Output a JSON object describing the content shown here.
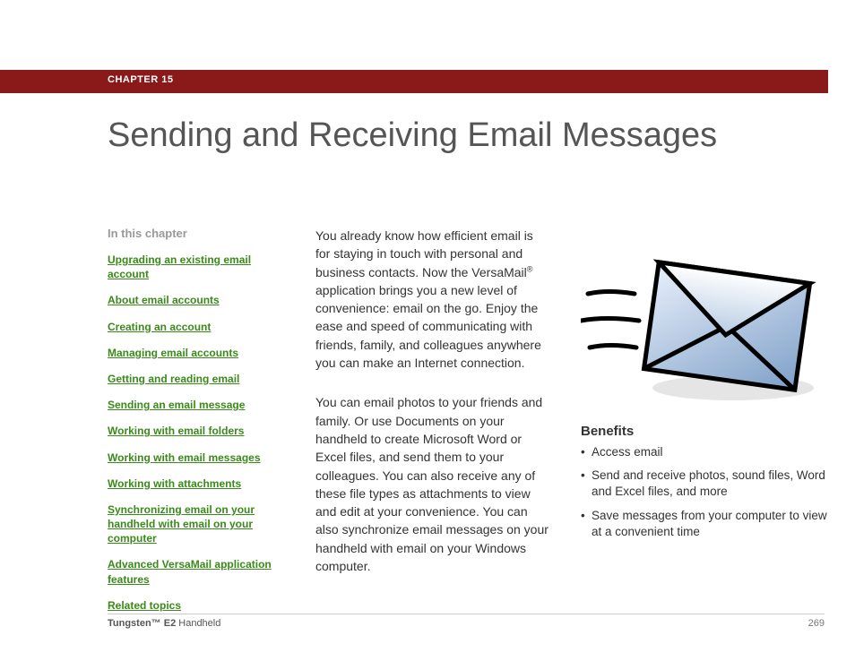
{
  "chapter": {
    "label": "CHAPTER 15"
  },
  "title": "Sending and Receiving Email Messages",
  "sidebar": {
    "heading": "In this chapter",
    "links": [
      "Upgrading an existing email account",
      "About email accounts",
      "Creating an account",
      "Managing email accounts",
      "Getting and reading email",
      "Sending an email message",
      "Working with email folders",
      "Working with email messages",
      "Working with attachments",
      "Synchronizing email on your handheld with email on your computer",
      "Advanced VersaMail application features",
      "Related topics"
    ]
  },
  "body": {
    "p1_a": "You already know how efficient email is for staying in touch with personal and business contacts. Now the VersaMail",
    "p1_b": " application brings you a new level of convenience: email on the go. Enjoy the ease and speed of communicating with friends, family, and colleagues anywhere you can make an Internet connection.",
    "reg": "®",
    "p2": "You can email photos to your friends and family. Or use Documents on your handheld to create Microsoft Word or Excel files, and send them to your colleagues. You can also receive any of these file types as attachments to view and edit at your convenience. You can also synchronize email messages on your handheld with email on your Windows computer."
  },
  "benefits": {
    "heading": "Benefits",
    "items": [
      "Access email",
      "Send and receive photos, sound files, Word and Excel files, and more",
      "Save messages from your computer to view at a convenient time"
    ]
  },
  "footer": {
    "product_bold": "Tungsten™ E2",
    "product_light": " Handheld",
    "page": "269"
  },
  "icon": {
    "name": "flying-envelope-icon"
  }
}
